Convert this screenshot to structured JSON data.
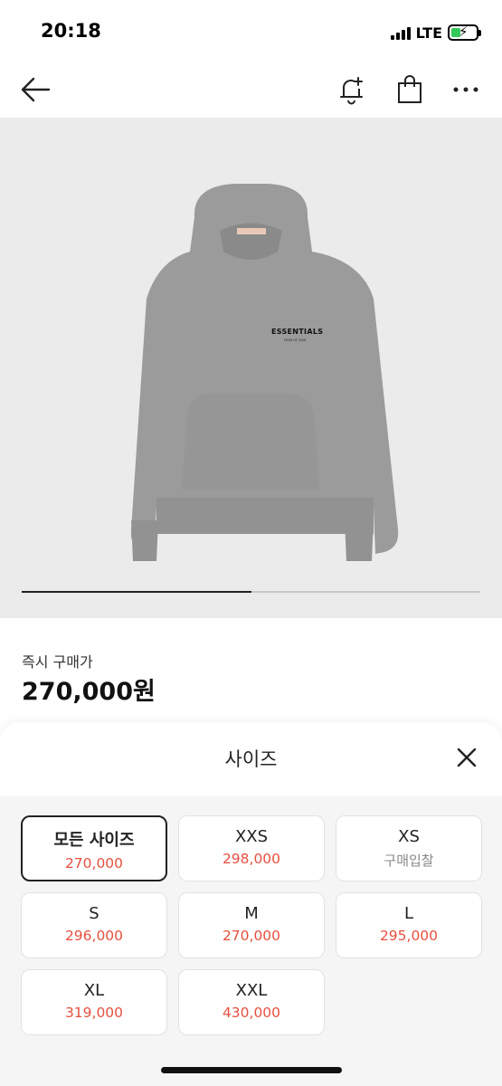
{
  "status_bar": {
    "time": "20:18",
    "network": "LTE",
    "battery_level": 0.4,
    "icons": [
      "signal-icon",
      "battery-charging-icon"
    ]
  },
  "nav": {
    "icons": [
      "back-arrow-icon",
      "bell-plus-icon",
      "shopping-bag-icon",
      "more-icon"
    ]
  },
  "product": {
    "image_icon": "hoodie-image",
    "image_print": "ESSENTIALS",
    "image_print_sub": "FEAR OF GOD",
    "gallery_progress": 0.5,
    "colors": {
      "background": "#ebebeb",
      "hoodie": "#999999"
    }
  },
  "price": {
    "label": "즉시 구매가",
    "value": "270,000원"
  },
  "sheet": {
    "title": "사이즈",
    "close_icon": "close-icon",
    "sizes": [
      {
        "name": "모든 사이즈",
        "price": "270,000",
        "selected": true
      },
      {
        "name": "XXS",
        "price": "298,000"
      },
      {
        "name": "XS",
        "price": "구매입찰",
        "is_bid": true
      },
      {
        "name": "S",
        "price": "296,000"
      },
      {
        "name": "M",
        "price": "270,000"
      },
      {
        "name": "L",
        "price": "295,000"
      },
      {
        "name": "XL",
        "price": "319,000"
      },
      {
        "name": "XXL",
        "price": "430,000"
      }
    ],
    "colors": {
      "price": "#e5503f",
      "bid": "#888888"
    }
  }
}
